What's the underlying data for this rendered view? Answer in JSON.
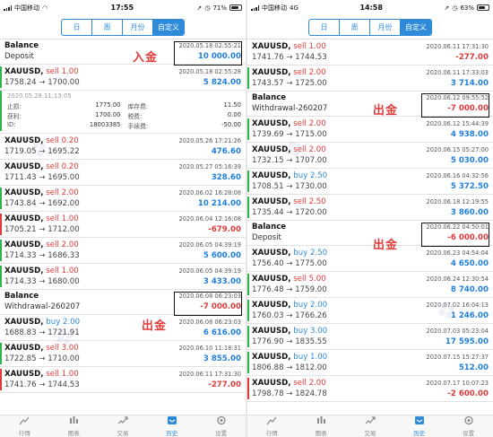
{
  "left": {
    "status": {
      "carrier": "中国移动",
      "time": "17:55",
      "battery": "71%"
    },
    "segments": [
      "日",
      "周",
      "月份",
      "自定义"
    ],
    "tabs": [
      "行情",
      "图表",
      "交易",
      "历史",
      "设置"
    ],
    "annotations": {
      "deposit": "入金",
      "withdraw": "出金"
    },
    "rows": [
      {
        "kind": "balance",
        "title": "Balance",
        "desc": "Deposit",
        "time": "2020.05.18 02:55:21",
        "profit": "10 000.00",
        "sign": "pos",
        "boxed": true
      },
      {
        "kind": "trade",
        "sym": "XAUUSD,",
        "side": "sell",
        "lots": "sell 1.00",
        "price": "1758.24 → 1700.00",
        "time": "2020.05.18 02:55:28",
        "profit": "5 824.00",
        "sign": "pos",
        "bar": "green",
        "expanded": true
      },
      {
        "kind": "trade",
        "sym": "XAUUSD,",
        "side": "sell",
        "lots": "sell 0.20",
        "price": "1719.05 → 1695.22",
        "time": "2020.05.26 17:21:26",
        "profit": "476.60",
        "sign": "pos",
        "bar": ""
      },
      {
        "kind": "trade",
        "sym": "XAUUSD,",
        "side": "sell",
        "lots": "sell 0.20",
        "price": "1711.43 → 1695.00",
        "time": "2020.05.27 05:16:39",
        "profit": "328.60",
        "sign": "pos",
        "bar": ""
      },
      {
        "kind": "trade",
        "sym": "XAUUSD,",
        "side": "sell",
        "lots": "sell 2.00",
        "price": "1743.84 → 1692.00",
        "time": "2020.06.02 16:28:08",
        "profit": "10 214.00",
        "sign": "pos",
        "bar": "green"
      },
      {
        "kind": "trade",
        "sym": "XAUUSD,",
        "side": "sell",
        "lots": "sell 1.00",
        "price": "1705.21 → 1712.00",
        "time": "2020.06.04 12:16:08",
        "profit": "-679.00",
        "sign": "neg",
        "bar": "red"
      },
      {
        "kind": "trade",
        "sym": "XAUUSD,",
        "side": "sell",
        "lots": "sell 2.00",
        "price": "1714.33 → 1686.33",
        "time": "2020.06.05 04:39:19",
        "profit": "5 600.00",
        "sign": "pos",
        "bar": "green"
      },
      {
        "kind": "trade",
        "sym": "XAUUSD,",
        "side": "sell",
        "lots": "sell 1.00",
        "price": "1714.33 → 1680.00",
        "time": "2020.06.05 04:39:19",
        "profit": "3 433.00",
        "sign": "pos",
        "bar": "green"
      },
      {
        "kind": "balance",
        "title": "Balance",
        "desc": "Withdrawal-260207",
        "time": "2020.06.08 06:23:03",
        "profit": "-7 000.00",
        "sign": "neg",
        "boxed": true
      },
      {
        "kind": "trade",
        "sym": "XAUUSD,",
        "side": "buy",
        "lots": "buy 2.00",
        "price": "1688.83 → 1721.91",
        "time": "2020.06.08 06:23:03",
        "profit": "6 616.00",
        "sign": "pos",
        "bar": ""
      },
      {
        "kind": "trade",
        "sym": "XAUUSD,",
        "side": "sell",
        "lots": "sell 3.00",
        "price": "1722.85 → 1710.00",
        "time": "2020.06.10 11:18:31",
        "profit": "3 855.00",
        "sign": "pos",
        "bar": "green"
      },
      {
        "kind": "trade",
        "sym": "XAUUSD,",
        "side": "sell",
        "lots": "sell 1.00",
        "price": "1741.76 → 1744.53",
        "time": "2020.06.11 17:31:30",
        "profit": "-277.00",
        "sign": "neg",
        "bar": "red"
      }
    ],
    "detail": {
      "datetime": "2020.05.28 11:13:05",
      "labels": {
        "sl": "止损:",
        "tp": "获利:",
        "id": "ID:",
        "swap": "库存费:",
        "tax": "税费:",
        "fee": "手续费:"
      },
      "values": {
        "sl": "1775.00",
        "tp": "1700.00",
        "id": "18003385",
        "swap": "11.50",
        "tax": "0.00",
        "fee": "-50.00"
      }
    }
  },
  "right": {
    "status": {
      "carrier": "中国移动",
      "net": "4G",
      "time": "14:58",
      "battery": "63%"
    },
    "segments": [
      "日",
      "周",
      "月份",
      "自定义"
    ],
    "tabs": [
      "行情",
      "图表",
      "交易",
      "历史",
      "设置"
    ],
    "annotations": {
      "withdraw": "出金",
      "withdraw2": "出金"
    },
    "rows": [
      {
        "kind": "trade",
        "sym": "XAUUSD,",
        "side": "sell",
        "lots": "sell 1.00",
        "price": "1741.76 → 1744.53",
        "time": "2020.06.11 17:31:30",
        "profit": "-277.00",
        "sign": "neg",
        "bar": ""
      },
      {
        "kind": "trade",
        "sym": "XAUUSD,",
        "side": "sell",
        "lots": "sell 2.00",
        "price": "1743.57 → 1725.00",
        "time": "2020.06.11 17:33:03",
        "profit": "3 714.00",
        "sign": "pos",
        "bar": "green"
      },
      {
        "kind": "balance",
        "title": "Balance",
        "desc": "Withdrawal-260207",
        "time": "2020.06.12 09:55:52",
        "profit": "-7 000.00",
        "sign": "neg",
        "boxed": true
      },
      {
        "kind": "trade",
        "sym": "XAUUSD,",
        "side": "sell",
        "lots": "sell 2.00",
        "price": "1739.69 → 1715.00",
        "time": "2020.06.12 15:44:39",
        "profit": "4 938.00",
        "sign": "pos",
        "bar": "green"
      },
      {
        "kind": "trade",
        "sym": "XAUUSD,",
        "side": "sell",
        "lots": "sell 2.00",
        "price": "1732.15 → 1707.00",
        "time": "2020.06.15 05:27:00",
        "profit": "5 030.00",
        "sign": "pos",
        "bar": ""
      },
      {
        "kind": "trade",
        "sym": "XAUUSD,",
        "side": "buy",
        "lots": "buy 2.50",
        "price": "1708.51 → 1730.00",
        "time": "2020.06.16 04:32:56",
        "profit": "5 372.50",
        "sign": "pos",
        "bar": "green"
      },
      {
        "kind": "trade",
        "sym": "XAUUSD,",
        "side": "sell",
        "lots": "sell 2.50",
        "price": "1735.44 → 1720.00",
        "time": "2020.06.18 12:19:55",
        "profit": "3 860.00",
        "sign": "pos",
        "bar": "green"
      },
      {
        "kind": "balance",
        "title": "Balance",
        "desc": "Deposit",
        "time": "2020.06.22 04:50:01",
        "profit": "-6 000.00",
        "sign": "neg",
        "boxed": true
      },
      {
        "kind": "trade",
        "sym": "XAUUSD,",
        "side": "buy",
        "lots": "buy 2.50",
        "price": "1756.40 → 1775.00",
        "time": "2020.06.23 04:54:04",
        "profit": "4 650.00",
        "sign": "pos",
        "bar": ""
      },
      {
        "kind": "trade",
        "sym": "XAUUSD,",
        "side": "sell",
        "lots": "sell 5.00",
        "price": "1776.48 → 1759.00",
        "time": "2020.06.24 12:30:54",
        "profit": "8 740.00",
        "sign": "pos",
        "bar": "green"
      },
      {
        "kind": "trade",
        "sym": "XAUUSD,",
        "side": "buy",
        "lots": "buy 2.00",
        "price": "1760.03 → 1766.26",
        "time": "2020.07.02 16:04:13",
        "profit": "1 246.00",
        "sign": "pos",
        "bar": "green"
      },
      {
        "kind": "trade",
        "sym": "XAUUSD,",
        "side": "buy",
        "lots": "buy 3.00",
        "price": "1776.90 → 1835.55",
        "time": "2020.07.03 05:23:04",
        "profit": "17 595.00",
        "sign": "pos",
        "bar": "green"
      },
      {
        "kind": "trade",
        "sym": "XAUUSD,",
        "side": "buy",
        "lots": "buy 1.00",
        "price": "1806.88 → 1812.00",
        "time": "2020.07.15 15:27:37",
        "profit": "512.00",
        "sign": "pos",
        "bar": "green"
      },
      {
        "kind": "trade",
        "sym": "XAUUSD,",
        "side": "sell",
        "lots": "sell 2.00",
        "price": "1798.78 → 1824.78",
        "time": "2020.07.17 10:07:23",
        "profit": "-2 600.00",
        "sign": "neg",
        "bar": "red"
      }
    ]
  },
  "colors": {
    "accent": "#2f8bd8",
    "profit": "#1f7fe0",
    "loss": "#e03a3a",
    "annotation": "#e03a3a"
  }
}
